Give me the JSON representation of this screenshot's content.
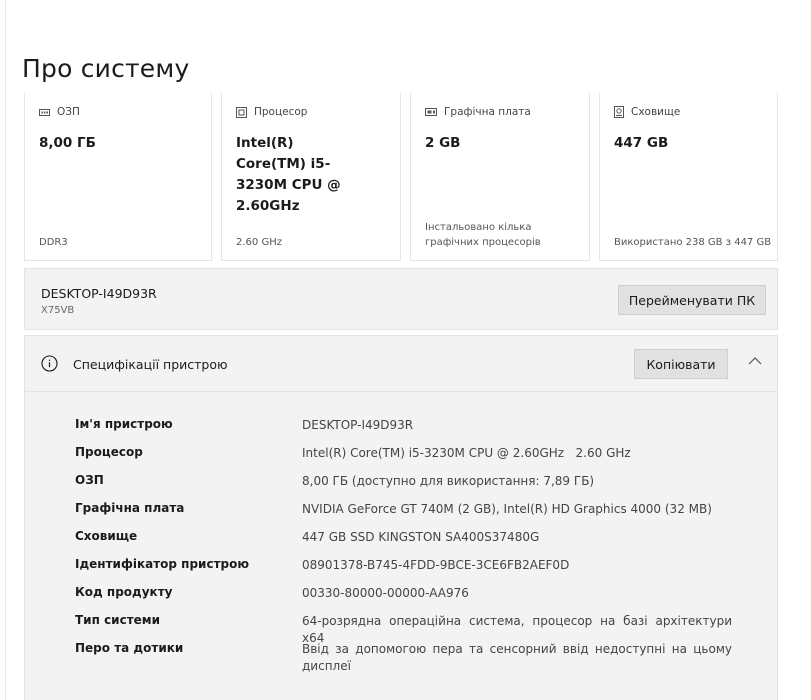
{
  "page": {
    "title": "Про систему"
  },
  "cards": [
    {
      "label": "ОЗП",
      "icon": "ram-icon",
      "value": "8,00 ГБ",
      "note": "DDR3"
    },
    {
      "label": "Процесор",
      "icon": "cpu-icon",
      "value": "Intel(R) Core(TM) i5-3230M CPU @ 2.60GHz",
      "note": "2.60 GHz"
    },
    {
      "label": "Графічна плата",
      "icon": "gpu-icon",
      "value": "2 GB",
      "note": "Інстальовано кілька графічних процесорів"
    },
    {
      "label": "Сховище",
      "icon": "storage-icon",
      "value": "447 GB",
      "note": "Використано 238 GB з 447 GB"
    }
  ],
  "device": {
    "name": "DESKTOP-I49D93R",
    "model": "X75VB",
    "rename_label": "Перейменувати ПК"
  },
  "specs": {
    "title": "Специфікації пристрою",
    "copy_label": "Копіювати",
    "rows": [
      {
        "label": "Ім'я пристрою",
        "value": "DESKTOP-I49D93R"
      },
      {
        "label": "Процесор",
        "value": "Intel(R) Core(TM) i5-3230M CPU @ 2.60GHz   2.60 GHz"
      },
      {
        "label": "ОЗП",
        "value": "8,00 ГБ (доступно для використання: 7,89 ГБ)"
      },
      {
        "label": "Графічна плата",
        "value": "NVIDIA GeForce GT 740M (2 GB), Intel(R) HD Graphics 4000 (32 MB)"
      },
      {
        "label": "Сховище",
        "value": "447 GB SSD KINGSTON SA400S37480G"
      },
      {
        "label": "Ідентифікатор пристрою",
        "value": "08901378-B745-4FDD-9BCE-3CE6FB2AEF0D"
      },
      {
        "label": "Код продукту",
        "value": "00330-80000-00000-AA976"
      },
      {
        "label": "Тип системи",
        "value": "64-розрядна операційна система, процесор на базі архітектури x64"
      },
      {
        "label": "Перо та дотики",
        "value": "Ввід за допомогою пера та сенсорний ввід недоступні на цьому дисплеї"
      }
    ]
  }
}
